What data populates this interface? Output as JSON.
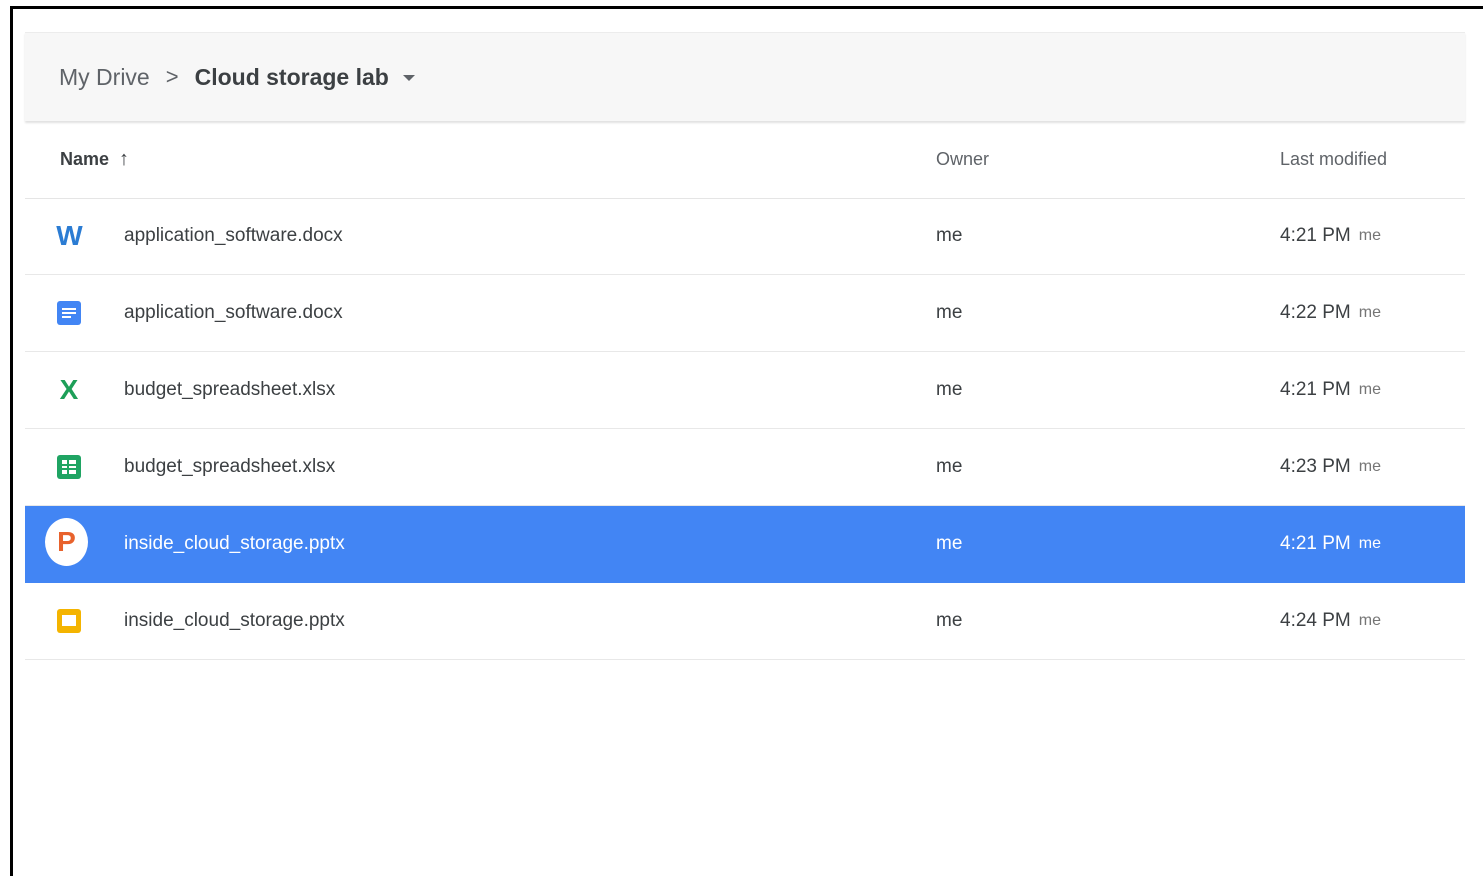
{
  "breadcrumb": {
    "root": "My Drive",
    "separator": ">",
    "current": "Cloud storage lab"
  },
  "columns": {
    "name": "Name",
    "sort_indicator": "↑",
    "owner": "Owner",
    "last_modified": "Last modified"
  },
  "files": [
    {
      "name": "application_software.docx",
      "icon": "word-icon",
      "icon_glyph": "W",
      "owner": "me",
      "time": "4:21 PM",
      "by": "me",
      "selected": false
    },
    {
      "name": "application_software.docx",
      "icon": "google-docs-icon",
      "owner": "me",
      "time": "4:22 PM",
      "by": "me",
      "selected": false
    },
    {
      "name": "budget_spreadsheet.xlsx",
      "icon": "excel-icon",
      "icon_glyph": "X",
      "owner": "me",
      "time": "4:21 PM",
      "by": "me",
      "selected": false
    },
    {
      "name": "budget_spreadsheet.xlsx",
      "icon": "google-sheets-icon",
      "owner": "me",
      "time": "4:23 PM",
      "by": "me",
      "selected": false
    },
    {
      "name": "inside_cloud_storage.pptx",
      "icon": "powerpoint-icon",
      "icon_glyph": "P",
      "owner": "me",
      "time": "4:21 PM",
      "by": "me",
      "selected": true
    },
    {
      "name": "inside_cloud_storage.pptx",
      "icon": "google-slides-icon",
      "owner": "me",
      "time": "4:24 PM",
      "by": "me",
      "selected": false
    }
  ],
  "colors": {
    "selection": "#4285f4",
    "word": "#2b7cd3",
    "excel": "#1d9f58",
    "powerpoint": "#e8622c",
    "docs": "#4285f4",
    "sheets": "#1fa463",
    "slides": "#f4b400"
  }
}
